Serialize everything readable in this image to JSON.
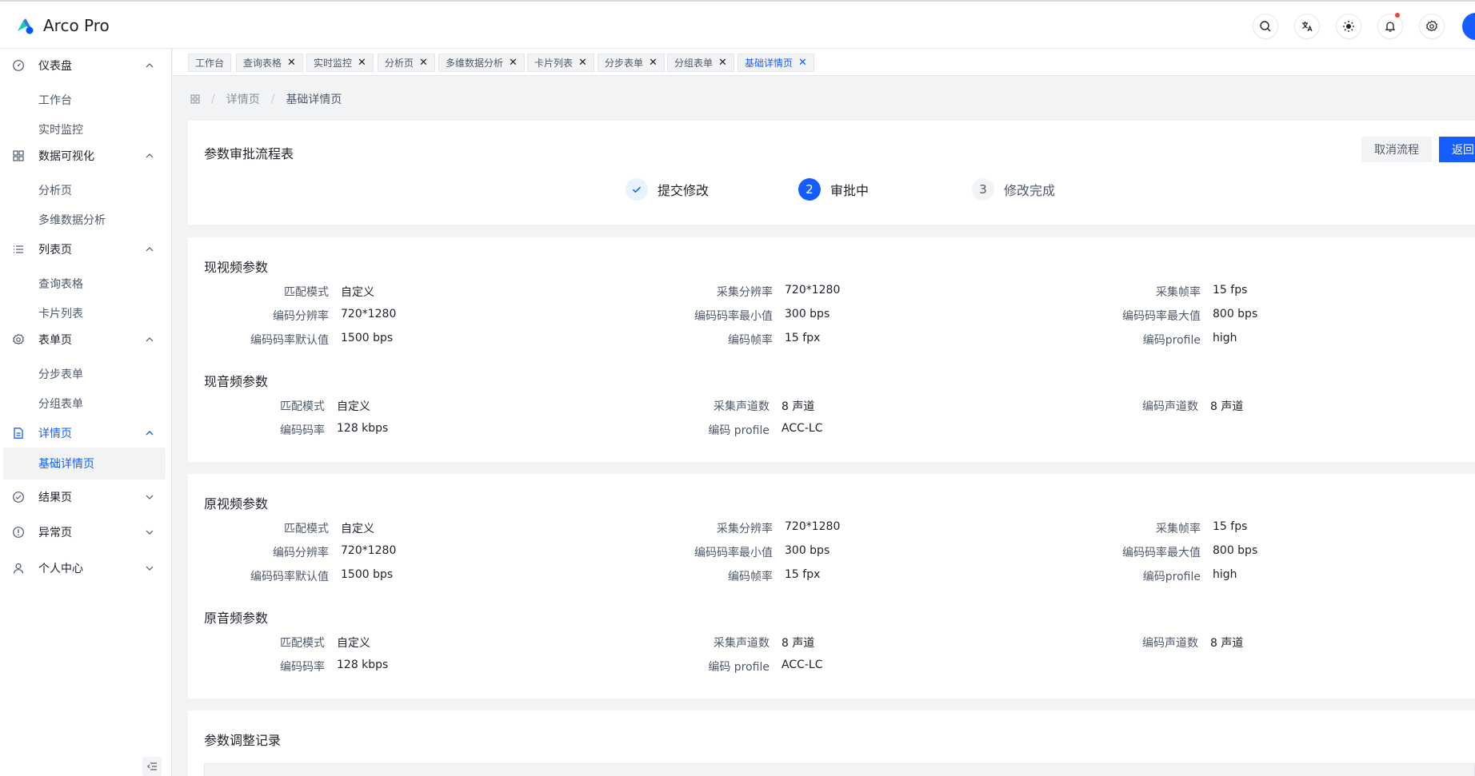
{
  "app": {
    "title": "Arco Pro"
  },
  "sidebar": {
    "groups": [
      {
        "label": "仪表盘",
        "items": [
          "工作台",
          "实时监控"
        ]
      },
      {
        "label": "数据可视化",
        "items": [
          "分析页",
          "多维数据分析"
        ]
      },
      {
        "label": "列表页",
        "items": [
          "查询表格",
          "卡片列表"
        ]
      },
      {
        "label": "表单页",
        "items": [
          "分步表单",
          "分组表单"
        ]
      },
      {
        "label": "详情页",
        "items": [
          "基础详情页"
        ]
      },
      {
        "label": "结果页"
      },
      {
        "label": "异常页"
      },
      {
        "label": "个人中心"
      }
    ]
  },
  "tabs": [
    "工作台",
    "查询表格",
    "实时监控",
    "分析页",
    "多维数据分析",
    "卡片列表",
    "分步表单",
    "分组表单",
    "基础详情页"
  ],
  "breadcrumb": {
    "level1": "详情页",
    "level2": "基础详情页"
  },
  "flow": {
    "title": "参数审批流程表",
    "cancel_label": "取消流程",
    "back_label": "返回",
    "steps": [
      {
        "label": "提交修改",
        "status": "finish"
      },
      {
        "num": "2",
        "label": "审批中",
        "status": "process"
      },
      {
        "num": "3",
        "label": "修改完成",
        "status": "wait"
      }
    ]
  },
  "current": {
    "video_title": "现视频参数",
    "video": [
      {
        "k": "匹配模式",
        "v": "自定义"
      },
      {
        "k": "采集分辨率",
        "v": "720*1280"
      },
      {
        "k": "采集帧率",
        "v": "15 fps"
      },
      {
        "k": "编码分辨率",
        "v": "720*1280"
      },
      {
        "k": "编码码率最小值",
        "v": "300 bps"
      },
      {
        "k": "编码码率最大值",
        "v": "800 bps"
      },
      {
        "k": "编码码率默认值",
        "v": "1500 bps"
      },
      {
        "k": "编码帧率",
        "v": "15 fpx"
      },
      {
        "k": "编码profile",
        "v": "high"
      }
    ],
    "audio_title": "现音频参数",
    "audio": [
      {
        "k": "匹配模式",
        "v": "自定义"
      },
      {
        "k": "采集声道数",
        "v": "8 声道"
      },
      {
        "k": "编码声道数",
        "v": "8 声道"
      },
      {
        "k": "编码码率",
        "v": "128 kbps"
      },
      {
        "k": "编码 profile",
        "v": "ACC-LC"
      }
    ]
  },
  "original": {
    "video_title": "原视频参数",
    "video": [
      {
        "k": "匹配模式",
        "v": "自定义"
      },
      {
        "k": "采集分辨率",
        "v": "720*1280"
      },
      {
        "k": "采集帧率",
        "v": "15 fps"
      },
      {
        "k": "编码分辨率",
        "v": "720*1280"
      },
      {
        "k": "编码码率最小值",
        "v": "300 bps"
      },
      {
        "k": "编码码率最大值",
        "v": "800 bps"
      },
      {
        "k": "编码码率默认值",
        "v": "1500 bps"
      },
      {
        "k": "编码帧率",
        "v": "15 fpx"
      },
      {
        "k": "编码profile",
        "v": "high"
      }
    ],
    "audio_title": "原音频参数",
    "audio": [
      {
        "k": "匹配模式",
        "v": "自定义"
      },
      {
        "k": "采集声道数",
        "v": "8 声道"
      },
      {
        "k": "编码声道数",
        "v": "8 声道"
      },
      {
        "k": "编码码率",
        "v": "128 kbps"
      },
      {
        "k": "编码 profile",
        "v": "ACC-LC"
      }
    ]
  },
  "records": {
    "title": "参数调整记录"
  },
  "colors": {
    "primary": "#165dff",
    "alert": "#f53f3f",
    "background": "#f2f3f5"
  },
  "icons": [
    "search-icon",
    "translate-icon",
    "sun-icon",
    "bell-icon",
    "gear-icon",
    "dashboard-icon",
    "grid-icon",
    "list-icon",
    "settings-icon",
    "file-icon",
    "check-circle-icon",
    "exclamation-circle-icon",
    "user-icon",
    "chevron-up-icon",
    "chevron-down-icon",
    "close-icon",
    "apps-icon",
    "menu-fold-icon"
  ]
}
